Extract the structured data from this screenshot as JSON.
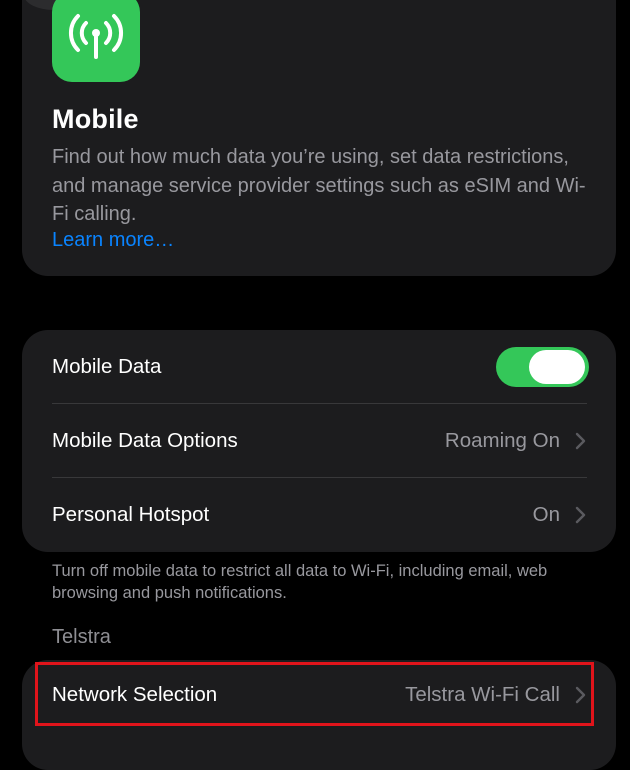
{
  "header": {
    "icon": "antenna-radiowaves-icon",
    "title": "Mobile",
    "description": "Find out how much data you’re using, set data restrictions, and manage service provider settings such as eSIM and Wi-Fi calling.",
    "link": "Learn more…"
  },
  "settings": {
    "mobile_data": {
      "label": "Mobile Data",
      "enabled": true
    },
    "mobile_data_options": {
      "label": "Mobile Data Options",
      "value": "Roaming On"
    },
    "personal_hotspot": {
      "label": "Personal Hotspot",
      "value": "On"
    }
  },
  "footer_note": "Turn off mobile data to restrict all data to Wi-Fi, including email, web browsing and push notifications.",
  "carrier_section": {
    "header": "Telstra",
    "network_selection": {
      "label": "Network Selection",
      "value": "Telstra Wi-Fi Call"
    }
  },
  "colors": {
    "background": "#000000",
    "card": "#1c1c1e",
    "accent_green": "#34c759",
    "link_blue": "#0a84ff",
    "secondary_text": "#98989e",
    "highlight_red": "#e0141b"
  }
}
